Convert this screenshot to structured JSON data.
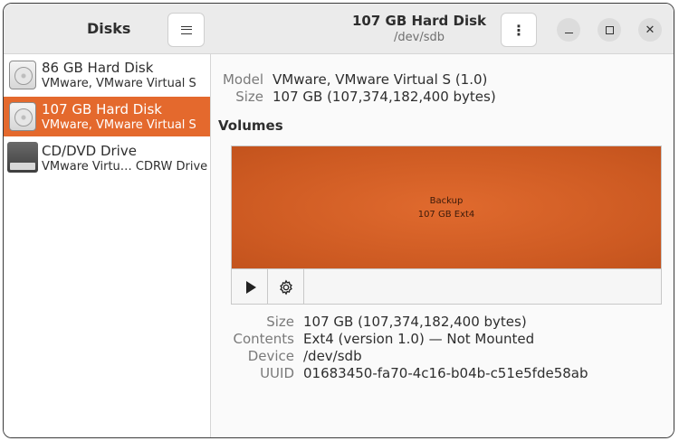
{
  "sidebar": {
    "title": "Disks",
    "disks": [
      {
        "name": "86 GB Hard Disk",
        "subtitle": "VMware, VMware Virtual S",
        "icon": "hard-disk-icon",
        "selected": false
      },
      {
        "name": "107 GB Hard Disk",
        "subtitle": "VMware, VMware Virtual S",
        "icon": "hard-disk-icon",
        "selected": true
      },
      {
        "name": "CD/DVD Drive",
        "subtitle": "VMware Virtu… CDRW Drive",
        "icon": "optical-drive-icon",
        "selected": false
      }
    ]
  },
  "header": {
    "title": "107 GB Hard Disk",
    "subtitle": "/dev/sdb",
    "menu_icon": "⋮",
    "minimize_icon": "minimize-icon",
    "maximize_icon": "maximize-icon",
    "close_icon": "✕"
  },
  "drive_info": {
    "model_label": "Model",
    "model_value": "VMware, VMware Virtual S (1.0)",
    "size_label": "Size",
    "size_value": "107 GB (107,374,182,400 bytes)"
  },
  "volumes": {
    "heading": "Volumes",
    "partition": {
      "name": "Backup",
      "detail": "107 GB Ext4"
    }
  },
  "volume_info": {
    "size_label": "Size",
    "size_value": "107 GB (107,374,182,400 bytes)",
    "contents_label": "Contents",
    "contents_value": "Ext4 (version 1.0) — Not Mounted",
    "device_label": "Device",
    "device_value": "/dev/sdb",
    "uuid_label": "UUID",
    "uuid_value": "01683450-fa70-4c16-b04b-c51e5fde58ab"
  },
  "colors": {
    "accent": "#e4692d",
    "partition": "#cd5a22"
  }
}
